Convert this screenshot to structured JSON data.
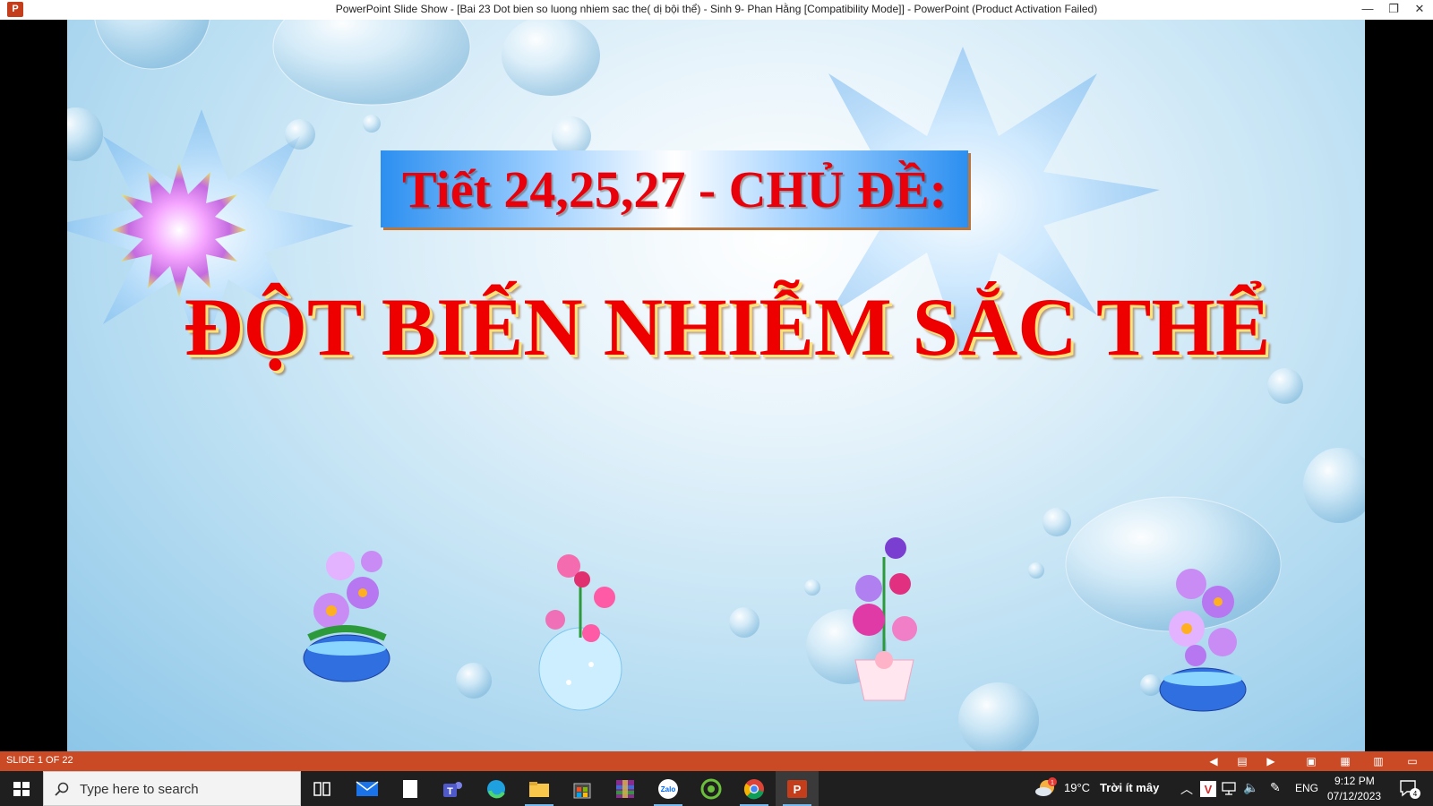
{
  "window": {
    "title": "PowerPoint Slide Show - [Bai 23 Dot bien so luong nhiem sac the( dị bội thể) - Sinh 9- Phan Hằng [Compatibility Mode]] - PowerPoint (Product Activation Failed)",
    "app_icon_letter": "P"
  },
  "slide": {
    "banner_title": "Tiết 24,25,27 - CHỦ ĐỀ:",
    "main_title": "ĐỘT BIẾN NHIỄM SẮC THỂ"
  },
  "statusbar": {
    "slide_counter": "SLIDE 1 OF 22"
  },
  "taskbar": {
    "search_placeholder": "Type here to search",
    "weather_temp": "19°C",
    "weather_desc": "Trời ít mây",
    "language": "ENG",
    "time": "9:12 PM",
    "date": "07/12/2023",
    "notification_count": "4",
    "weather_badge": "1",
    "zalo_label": "Zalo"
  },
  "colors": {
    "status_bar": "#c94a25",
    "title_red": "#e8000b",
    "taskbar": "#1f1f1f"
  }
}
